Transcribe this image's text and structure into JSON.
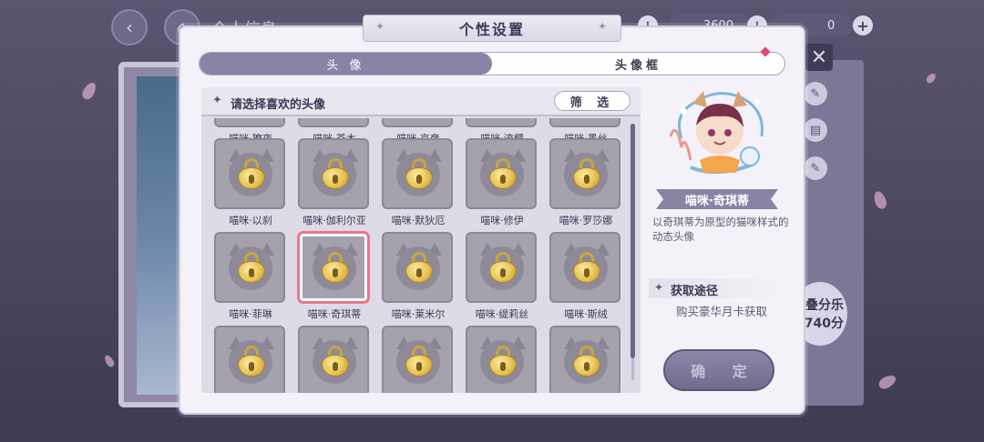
{
  "background": {
    "title": "个人信息",
    "currency_1": "3600",
    "currency_2": "0",
    "score_line_1": "叠分乐",
    "score_line_2": "740分"
  },
  "dialog": {
    "title": "个性设置",
    "tabs": [
      {
        "label": "头 像",
        "active": true
      },
      {
        "label": "头像框",
        "active": false
      }
    ],
    "list_header": "请选择喜欢的头像",
    "filter_label": "筛 选",
    "rows": [
      {
        "items": [
          "喵咪·獠夜",
          "喵咪·苍木",
          "喵咪·京彦",
          "喵咪·流樱",
          "喵咪·墨丝"
        ]
      },
      {
        "items": [
          "喵咪·以刹",
          "喵咪·伽利尔亚",
          "喵咪·默狄厄",
          "喵咪·修伊",
          "喵咪·罗莎娜"
        ]
      },
      {
        "items": [
          "喵咪·菲琳",
          "喵咪·奇琪蒂",
          "喵咪·莱米尔",
          "喵咪·缇莉丝",
          "喵咪·斯绒"
        ]
      },
      {
        "items": [
          "",
          "",
          "",
          "",
          ""
        ]
      }
    ],
    "selected": "喵咪·奇琪蒂",
    "preview": {
      "name": "喵咪·奇琪蒂",
      "description": "以奇琪蒂为原型的猫咪样式的动态头像",
      "acquire_title": "获取途径",
      "acquire_method": "购买豪华月卡获取"
    },
    "confirm_label": "确 定"
  },
  "colors": {
    "accent": "#8a83a6",
    "selected_border": "#e8788c",
    "lock_gold": "#e7c455"
  }
}
